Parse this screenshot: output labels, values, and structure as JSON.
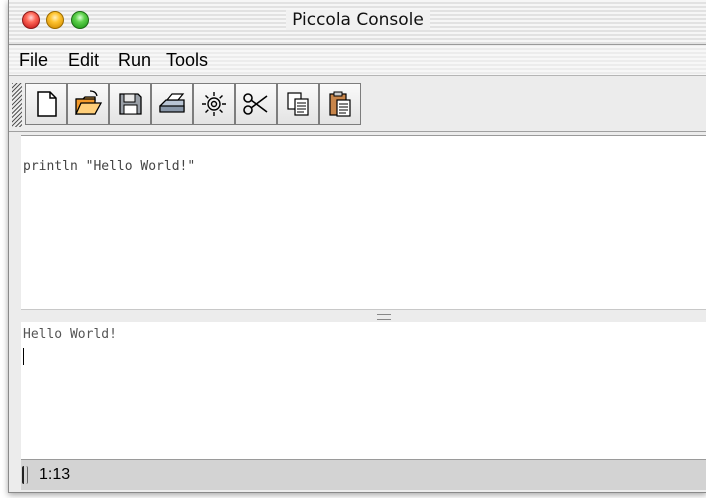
{
  "window": {
    "title": "Piccola Console"
  },
  "menubar": {
    "items": [
      "File",
      "Edit",
      "Run",
      "Tools"
    ]
  },
  "toolbar": {
    "buttons": [
      "new-file-icon",
      "open-folder-icon",
      "save-disk-icon",
      "print-icon",
      "settings-gear-icon",
      "cut-scissors-icon",
      "copy-icon",
      "paste-icon"
    ]
  },
  "editor": {
    "code": "println \"Hello World!\""
  },
  "output": {
    "text": "Hello World!"
  },
  "status": {
    "position": "1:13"
  }
}
